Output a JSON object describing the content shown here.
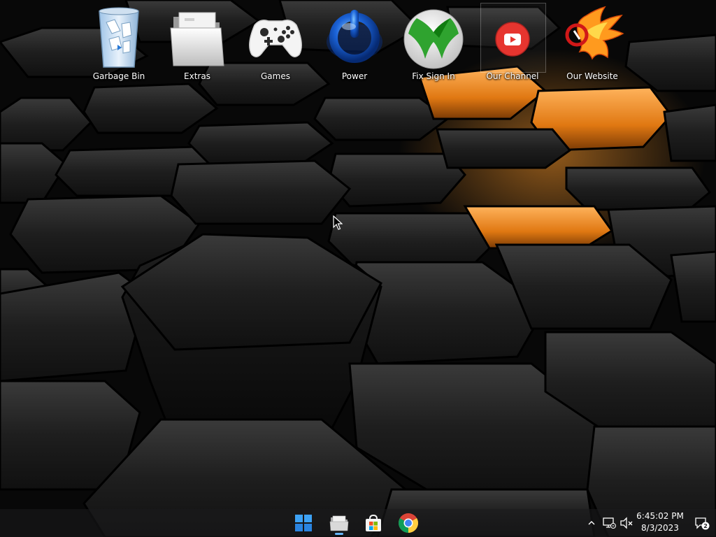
{
  "desktop": {
    "icons": [
      {
        "label": "Garbage Bin",
        "icon": "recycle-bin-icon"
      },
      {
        "label": "Extras",
        "icon": "folder-icon"
      },
      {
        "label": "Games",
        "icon": "game-controller-icon"
      },
      {
        "label": "Power",
        "icon": "power-icon"
      },
      {
        "label": "Fix Sign In",
        "icon": "xbox-icon"
      },
      {
        "label": "Our Channel",
        "icon": "youtube-icon",
        "selected": true
      },
      {
        "label": "Our Website",
        "icon": "phoenix-logo-icon"
      }
    ]
  },
  "taskbar": {
    "pinned": [
      {
        "name": "start",
        "icon": "windows-logo-icon"
      },
      {
        "name": "file-explorer",
        "icon": "file-explorer-icon"
      },
      {
        "name": "microsoft-store",
        "icon": "store-icon"
      },
      {
        "name": "chrome",
        "icon": "chrome-icon"
      }
    ],
    "tray": {
      "icons": [
        "chevron-up-icon",
        "network-icon",
        "volume-muted-icon"
      ],
      "time": "6:45:02 PM",
      "date": "8/3/2023",
      "notification_count": "2"
    }
  },
  "colors": {
    "accent_orange": "#ff8c1a",
    "taskbar_indicator": "#66b6ff",
    "xbox_green": "#107c10",
    "youtube_red": "#e52d27"
  }
}
